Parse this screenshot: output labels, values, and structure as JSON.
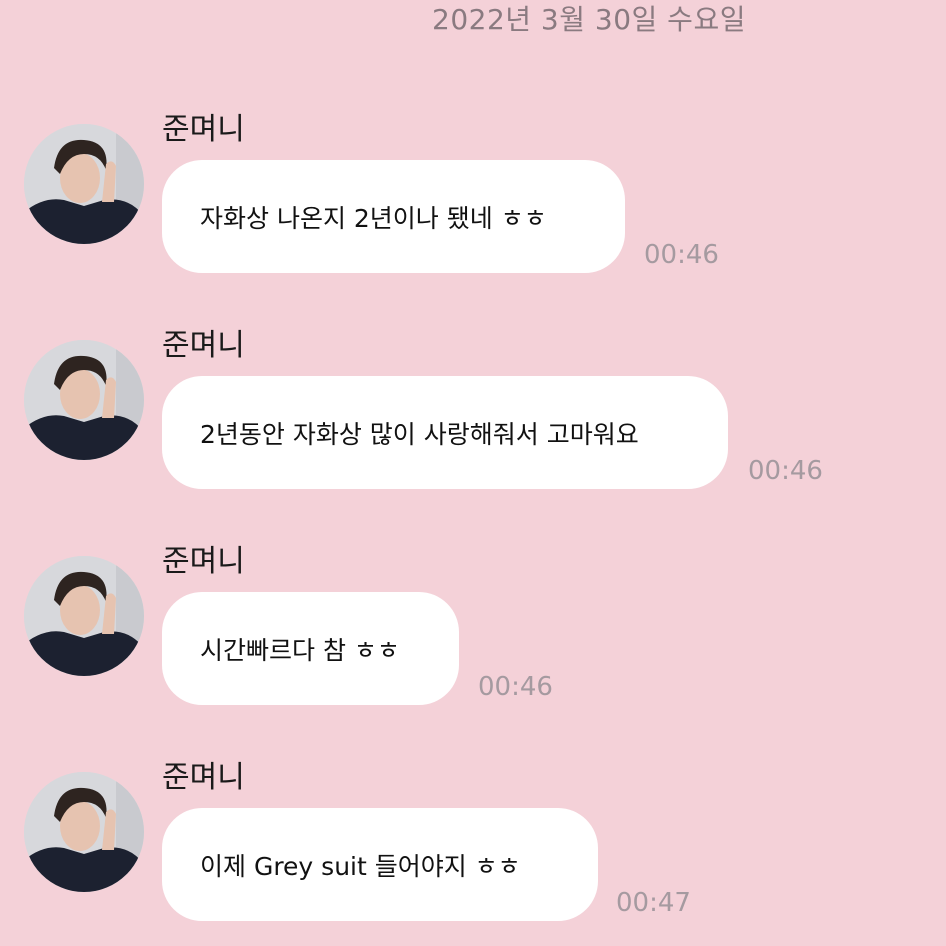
{
  "date_header": "2022년 3월 30일 수요일",
  "messages": [
    {
      "sender": "준며니",
      "text": "자화상 나온지 2년이나 됐네 ㅎㅎ",
      "time": "00:46"
    },
    {
      "sender": "준며니",
      "text": "2년동안 자화상 많이 사랑해줘서 고마워요",
      "time": "00:46"
    },
    {
      "sender": "준며니",
      "text": "시간빠르다 참 ㅎㅎ",
      "time": "00:46"
    },
    {
      "sender": "준며니",
      "text": "이제 Grey suit 들어야지 ㅎㅎ",
      "time": "00:47"
    }
  ],
  "colors": {
    "background": "#f4d1d8",
    "bubble": "#ffffff",
    "timestamp": "#a59aa0",
    "date_header": "#8a7a80"
  },
  "icons": {
    "avatar": "profile-photo"
  }
}
